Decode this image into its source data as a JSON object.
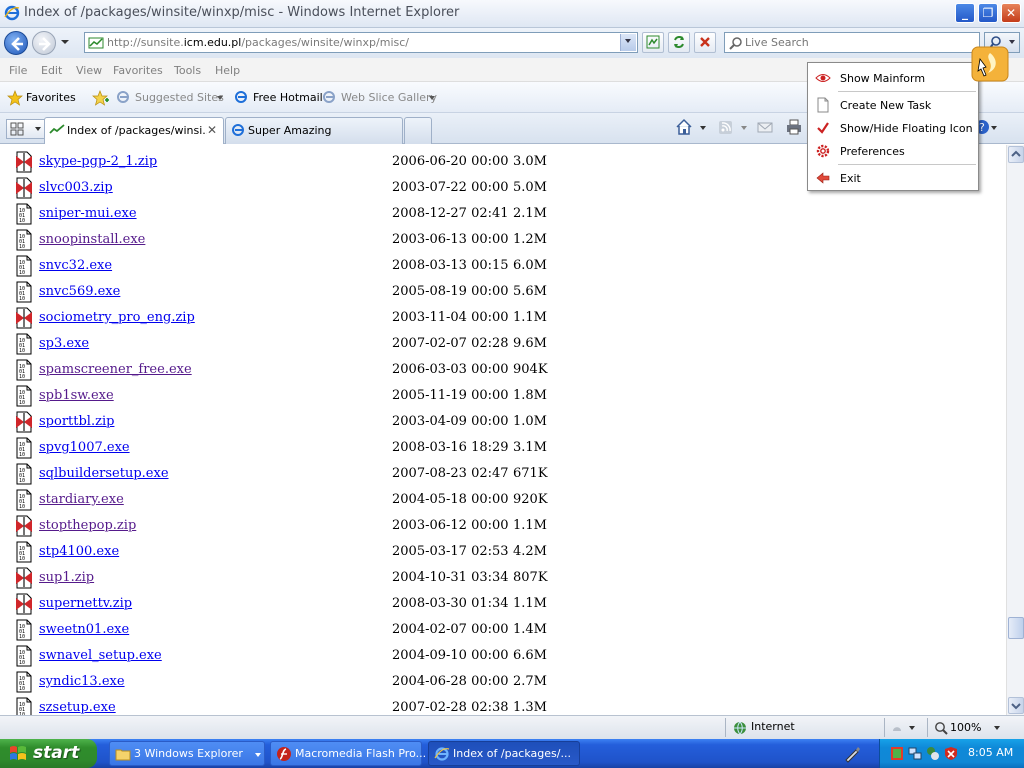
{
  "window": {
    "title": "Index of /packages/winsite/winxp/misc - Windows Internet Explorer"
  },
  "address": {
    "url_prefix": "http://sunsite.",
    "url_domain": "icm.edu.pl",
    "url_suffix": "/packages/winsite/winxp/misc/"
  },
  "search": {
    "placeholder": "Live Search"
  },
  "menu": [
    "File",
    "Edit",
    "View",
    "Favorites",
    "Tools",
    "Help"
  ],
  "favorites": {
    "label": "Favorites",
    "items": [
      "Suggested Sites",
      "Free Hotmail",
      "Web Slice Gallery"
    ]
  },
  "tabs": [
    {
      "label": "Index of /packages/winsi...",
      "active": true
    },
    {
      "label": "Super Amazing",
      "active": false
    }
  ],
  "files": [
    {
      "name": "skype-pgp-2_1.zip",
      "date": "2006-06-20 00:00",
      "size": "3.0M",
      "type": "zip",
      "visited": false
    },
    {
      "name": "slvc003.zip",
      "date": "2003-07-22 00:00",
      "size": "5.0M",
      "type": "zip",
      "visited": false
    },
    {
      "name": "sniper-mui.exe",
      "date": "2008-12-27 02:41",
      "size": "2.1M",
      "type": "exe",
      "visited": false
    },
    {
      "name": "snoopinstall.exe",
      "date": "2003-06-13 00:00",
      "size": "1.2M",
      "type": "exe",
      "visited": true
    },
    {
      "name": "snvc32.exe",
      "date": "2008-03-13 00:15",
      "size": "6.0M",
      "type": "exe",
      "visited": false
    },
    {
      "name": "snvc569.exe",
      "date": "2005-08-19 00:00",
      "size": "5.6M",
      "type": "exe",
      "visited": false
    },
    {
      "name": "sociometry_pro_eng.zip",
      "date": "2003-11-04 00:00",
      "size": "1.1M",
      "type": "zip",
      "visited": false
    },
    {
      "name": "sp3.exe",
      "date": "2007-02-07 02:28",
      "size": "9.6M",
      "type": "exe",
      "visited": false
    },
    {
      "name": "spamscreener_free.exe",
      "date": "2006-03-03 00:00",
      "size": "904K",
      "type": "exe",
      "visited": true
    },
    {
      "name": "spb1sw.exe",
      "date": "2005-11-19 00:00",
      "size": "1.8M",
      "type": "exe",
      "visited": true
    },
    {
      "name": "sporttbl.zip",
      "date": "2003-04-09 00:00",
      "size": "1.0M",
      "type": "zip",
      "visited": false
    },
    {
      "name": "spvg1007.exe",
      "date": "2008-03-16 18:29",
      "size": "3.1M",
      "type": "exe",
      "visited": false
    },
    {
      "name": "sqlbuildersetup.exe",
      "date": "2007-08-23 02:47",
      "size": "671K",
      "type": "exe",
      "visited": false
    },
    {
      "name": "stardiary.exe",
      "date": "2004-05-18 00:00",
      "size": "920K",
      "type": "exe",
      "visited": true
    },
    {
      "name": "stopthepop.zip",
      "date": "2003-06-12 00:00",
      "size": "1.1M",
      "type": "zip",
      "visited": true
    },
    {
      "name": "stp4100.exe",
      "date": "2005-03-17 02:53",
      "size": "4.2M",
      "type": "exe",
      "visited": false
    },
    {
      "name": "sup1.zip",
      "date": "2004-10-31 03:34",
      "size": "807K",
      "type": "zip",
      "visited": true
    },
    {
      "name": "supernettv.zip",
      "date": "2008-03-30 01:34",
      "size": "1.1M",
      "type": "zip",
      "visited": false
    },
    {
      "name": "sweetn01.exe",
      "date": "2004-02-07 00:00",
      "size": "1.4M",
      "type": "exe",
      "visited": false
    },
    {
      "name": "swnavel_setup.exe",
      "date": "2004-09-10 00:00",
      "size": "6.6M",
      "type": "exe",
      "visited": false
    },
    {
      "name": "syndic13.exe",
      "date": "2004-06-28 00:00",
      "size": "2.7M",
      "type": "exe",
      "visited": false
    },
    {
      "name": "szsetup.exe",
      "date": "2007-02-28 02:38",
      "size": "1.3M",
      "type": "exe",
      "visited": false
    }
  ],
  "status": {
    "zone": "Internet",
    "zoom": "100%"
  },
  "context_menu": {
    "items": [
      "Show Mainform",
      "Create New Task",
      "Show/Hide Floating Icon",
      "Preferences",
      "Exit"
    ]
  },
  "taskbar": {
    "start_label": "start",
    "items": [
      {
        "label": "3 Windows Explorer",
        "active": false
      },
      {
        "label": "Macromedia Flash Pro...",
        "active": false
      },
      {
        "label": "Index of /packages/...",
        "active": true
      }
    ],
    "clock": "8:05 AM"
  }
}
